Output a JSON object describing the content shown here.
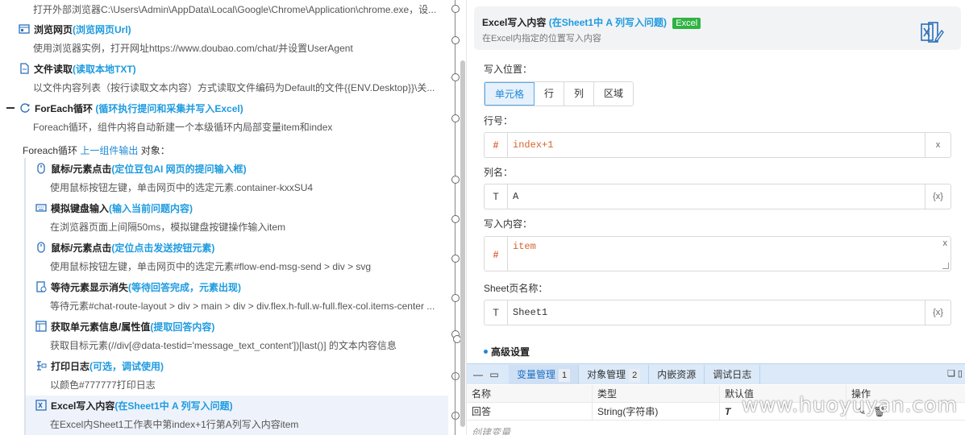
{
  "flow": {
    "top_desc": "打开外部浏览器C:\\Users\\Admin\\AppData\\Local\\Google\\Chrome\\Application\\chrome.exe，设...",
    "steps": [
      {
        "icon": "browser-icon",
        "title": "浏览网页",
        "subtitle": "(浏览网页Url)",
        "desc": "使用浏览器实例，打开网址https://www.doubao.com/chat/并设置UserAgent"
      },
      {
        "icon": "file-icon",
        "title": "文件读取",
        "subtitle": "(读取本地TXT)",
        "desc": "以文件内容列表（按行读取文本内容）方式读取文件编码为Default的文件{{ENV.Desktop}}\\关..."
      },
      {
        "icon": "loop-icon",
        "title": "ForEach循环",
        "subtitle": "(循环执行提问和采集并写入Excel)",
        "desc": "Foreach循环，组件内将自动新建一个本级循环内局部变量item和index"
      }
    ],
    "loop_label": {
      "prefix": "Foreach循环",
      "link": "上一组件输出",
      "suffix": "对象："
    },
    "inner_steps": [
      {
        "icon": "mouse-icon",
        "title": "鼠标/元素点击",
        "subtitle": "(定位豆包AI 网页的提问输入框)",
        "desc": "使用鼠标按钮左键，单击网页中的选定元素.container-kxxSU4"
      },
      {
        "icon": "keyboard-icon",
        "title": "模拟键盘输入",
        "subtitle": "(输入当前问题内容)",
        "desc": "在浏览器页面上间隔50ms，模拟键盘按键操作输入item"
      },
      {
        "icon": "mouse-icon",
        "title": "鼠标/元素点击",
        "subtitle": "(定位点击发送按钮元素)",
        "desc": "使用鼠标按钮左键，单击网页中的选定元素#flow-end-msg-send > div > svg"
      },
      {
        "icon": "wait-icon",
        "title": "等待元素显示消失",
        "subtitle": "(等待回答完成，元素出现)",
        "desc": "等待元素#chat-route-layout > div > main > div > div.flex.h-full.w-full.flex-col.items-center ..."
      },
      {
        "icon": "element-info-icon",
        "title": "获取单元素信息/属性值",
        "subtitle": "(提取回答内容)",
        "desc": "获取目标元素(//div[@data-testid='message_text_content'])[last()] 的文本内容信息"
      },
      {
        "icon": "log-icon",
        "title": "打印日志",
        "subtitle": "(可选，调试使用)",
        "desc": "以颜色#777777打印日志"
      },
      {
        "icon": "excel-icon",
        "title": "Excel写入内容",
        "subtitle": "(在Sheet1中 A 列写入问题)",
        "desc": "在Excel内Sheet1工作表中第index+1行第A列写入内容item"
      }
    ]
  },
  "panel": {
    "title": "Excel写入内容",
    "subtitle": "(在Sheet1中 A 列写入问题)",
    "badge": "Excel",
    "desc": "在Excel内指定的位置写入内容",
    "position_label": "写入位置：",
    "position_options": [
      "单元格",
      "行",
      "列",
      "区域"
    ],
    "selected_option": "单元格",
    "row_label": "行号：",
    "row_prefix": "#",
    "row_value": "index+1",
    "row_suffix": "x",
    "col_label": "列名：",
    "col_prefix": "T",
    "col_value": "A",
    "col_suffix": "{x}",
    "content_label": "写入内容：",
    "content_prefix": "#",
    "content_value": "item",
    "content_clear": "x",
    "sheet_label": "Sheet页名称：",
    "sheet_prefix": "T",
    "sheet_value": "Sheet1",
    "sheet_suffix": "{x}",
    "advanced_label": "高级设置"
  },
  "bottom": {
    "tabs": [
      {
        "label": "变量管理",
        "count": "1"
      },
      {
        "label": "对象管理",
        "count": "2"
      },
      {
        "label": "内嵌资源",
        "count": ""
      },
      {
        "label": "调试日志",
        "count": ""
      }
    ],
    "columns": [
      "名称",
      "类型",
      "默认值",
      "操作"
    ],
    "rows": [
      {
        "name": "回答",
        "type": "String(字符串)",
        "default": "T"
      }
    ],
    "create_label": "创建变量"
  },
  "watermark": "www.huoyuyan.com",
  "colors": {
    "accent": "#1e9be0",
    "badge": "#2fb344",
    "orange": "#d9622b"
  }
}
